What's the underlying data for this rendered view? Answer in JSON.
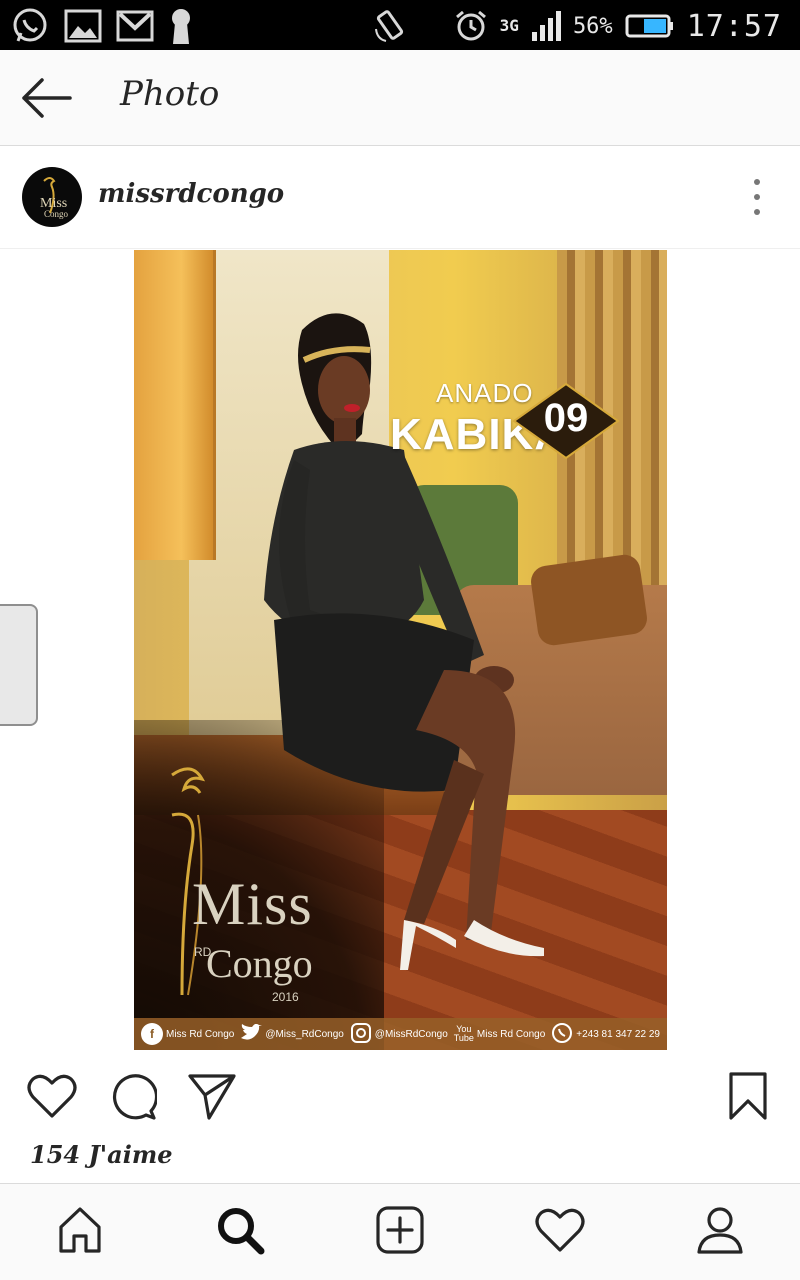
{
  "status_bar": {
    "icons_left": [
      "whatsapp-icon",
      "image-icon",
      "gmail-icon",
      "keyhole-icon"
    ],
    "icons_right": [
      "rotate-icon",
      "alarm-icon",
      "network-icon",
      "signal-icon",
      "battery-icon"
    ],
    "network": "3G",
    "battery": "56%",
    "time": "17:57"
  },
  "header": {
    "back_icon": "arrow-left-icon",
    "title": "Photo"
  },
  "post": {
    "username": "missrdcongo",
    "avatar_icon": "miss-rd-congo-logo",
    "more_icon": "more-vertical-icon",
    "image": {
      "first_name": "ANADO",
      "last_name": "KABIKA",
      "number": "09",
      "logo_miss": "Miss",
      "logo_rd": "RD",
      "logo_congo": "Congo",
      "logo_year": "2016",
      "footer": {
        "facebook": "Miss Rd Congo",
        "twitter": "@Miss_RdCongo",
        "instagram": "@MissRdCongo",
        "youtube_label_1": "You",
        "youtube_label_2": "Tube",
        "youtube": "Miss Rd Congo",
        "whatsapp": "+243 81 347 22 29"
      }
    },
    "actions": [
      "heart-icon",
      "comment-icon",
      "share-icon",
      "bookmark-icon"
    ],
    "likes": "154 J'aime"
  },
  "bottom_nav": [
    "home-icon",
    "search-icon",
    "add-icon",
    "activity-icon",
    "profile-icon"
  ],
  "colors": {
    "status_bar_bg": "#000000",
    "header_bg": "#fafafa",
    "text": "#262626",
    "divider": "#dbdbdb"
  }
}
